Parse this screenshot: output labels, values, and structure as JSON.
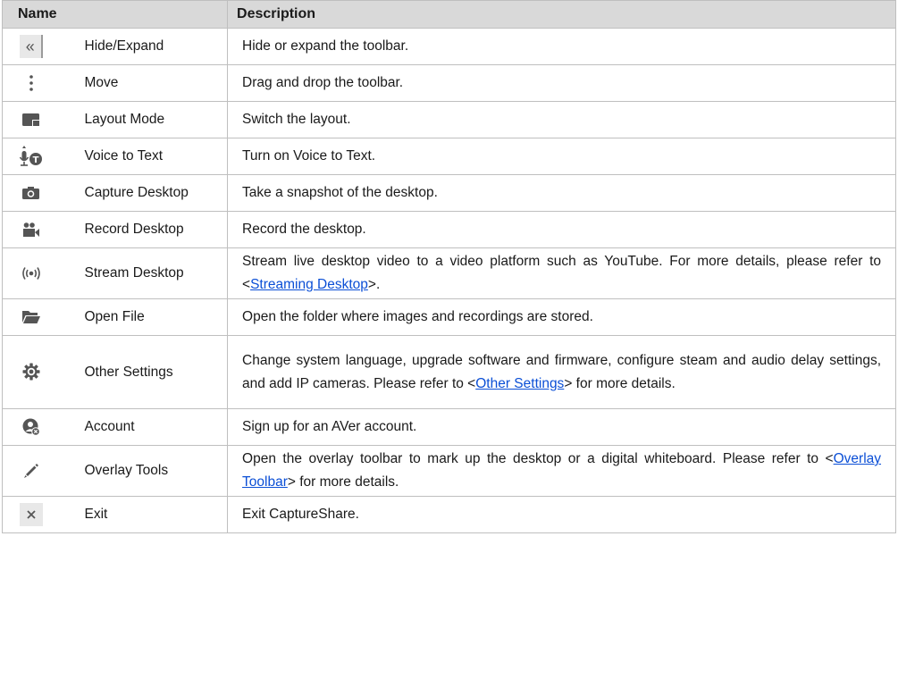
{
  "header": {
    "name": "Name",
    "description": "Description"
  },
  "rows": [
    {
      "icon": "hide-expand-icon",
      "name": "Hide/Expand",
      "desc": "Hide or expand the toolbar."
    },
    {
      "icon": "move-icon",
      "name": "Move",
      "desc": "Drag and drop the toolbar."
    },
    {
      "icon": "layout-mode-icon",
      "name": "Layout Mode",
      "desc": "Switch the layout."
    },
    {
      "icon": "voice-to-text-icon",
      "name": "Voice to Text",
      "desc": "Turn on Voice to Text."
    },
    {
      "icon": "camera-icon",
      "name": "Capture Desktop",
      "desc": "Take a snapshot of the desktop."
    },
    {
      "icon": "video-camera-icon",
      "name": "Record Desktop",
      "desc": "Record the desktop."
    },
    {
      "icon": "stream-icon",
      "name": "Stream Desktop",
      "desc_pre": "Stream live desktop video to a video platform such as YouTube. For more details, please refer to <",
      "desc_link": "Streaming Desktop",
      "desc_post": ">."
    },
    {
      "icon": "folder-open-icon",
      "name": "Open File",
      "desc": "Open the folder where images and recordings are stored."
    },
    {
      "icon": "gear-icon",
      "name": "Other Settings",
      "desc_pre": "Change system language, upgrade software and firmware, configure steam and audio delay settings, and add IP cameras. Please refer to <",
      "desc_link": "Other Settings",
      "desc_post": "> for more details."
    },
    {
      "icon": "account-icon",
      "name": "Account",
      "desc": "Sign up for an AVer account."
    },
    {
      "icon": "pencil-icon",
      "name": "Overlay Tools",
      "desc_pre": "Open the overlay toolbar to mark up the desktop or a digital whiteboard. Please refer to <",
      "desc_link": "Overlay Toolbar",
      "desc_post": "> for more details."
    },
    {
      "icon": "close-icon",
      "name": "Exit",
      "desc": "Exit CaptureShare."
    }
  ]
}
